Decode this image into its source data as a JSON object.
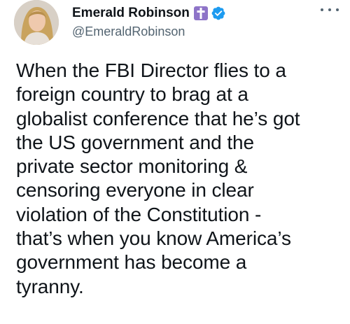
{
  "author": {
    "display_name": "Emerald Robinson",
    "handle": "@EmeraldRobinson",
    "badges": [
      "latin-cross-emoji",
      "verified-badge"
    ]
  },
  "tweet": {
    "text": "When the FBI Director flies to a\nforeign country to brag at a\nglobalist conference that he’s got\nthe US government and the\nprivate sector monitoring &\ncensoring everyone in clear\nviolation of the Constitution -\nthat’s when you know America’s\ngovernment has become a\ntyranny."
  },
  "icons": {
    "more": "more-horizontal-icon"
  },
  "colors": {
    "verified": "#1d9bf0",
    "cross_badge": "#8e74c8",
    "handle": "#536471",
    "text": "#0f1419"
  }
}
